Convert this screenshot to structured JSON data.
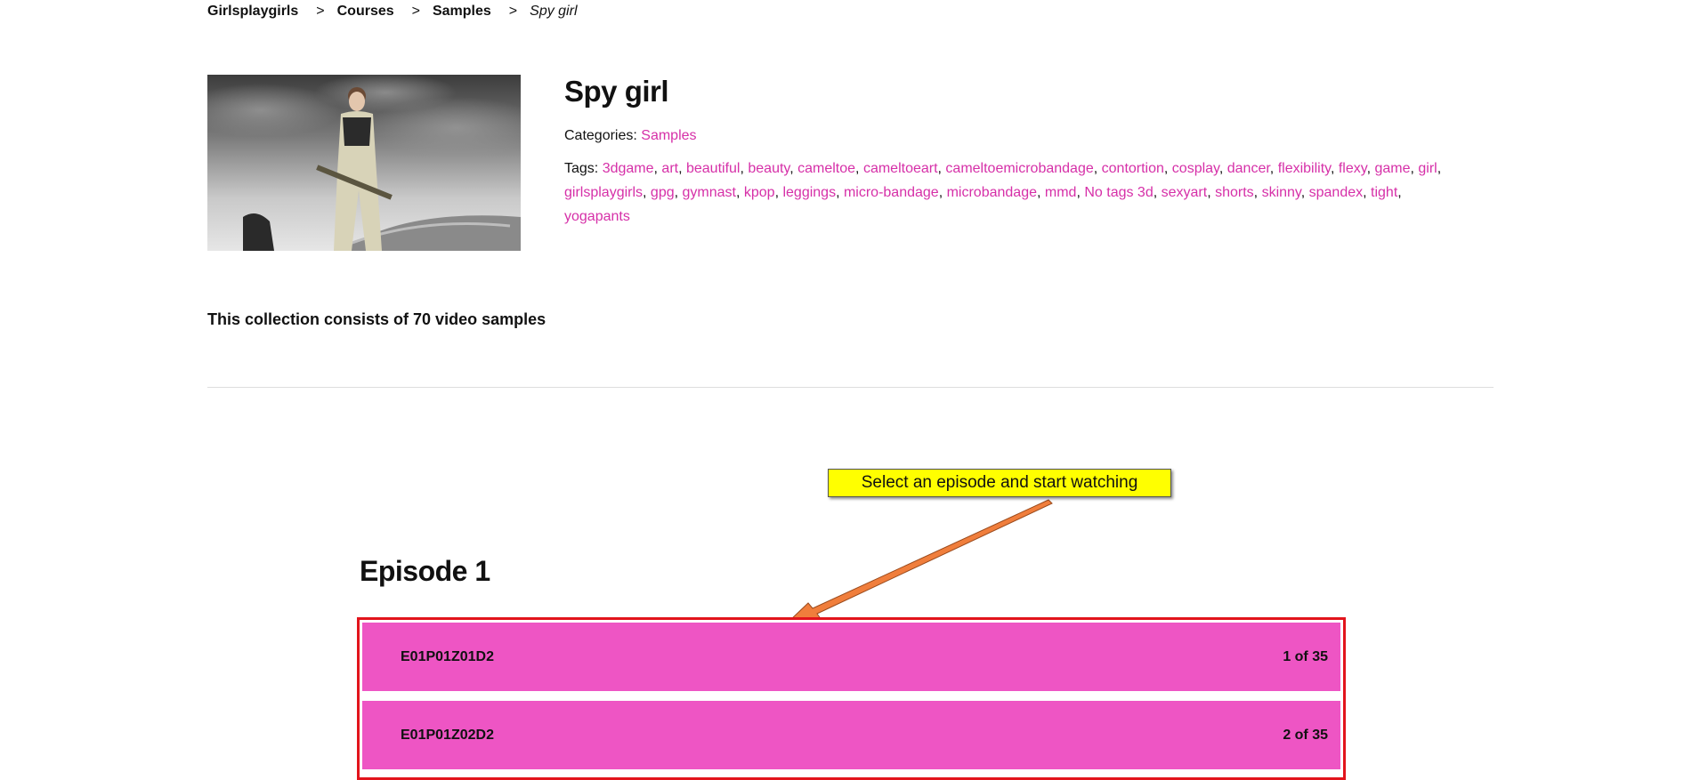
{
  "breadcrumb": {
    "items": [
      "Girlsplaygirls",
      "Courses",
      "Samples"
    ],
    "current": "Spy girl",
    "separator": ">"
  },
  "course": {
    "title": "Spy girl",
    "categories_label": "Categories:",
    "category": "Samples",
    "tags_label": "Tags:",
    "tags": [
      "3dgame",
      "art",
      "beautiful",
      "beauty",
      "cameltoe",
      "cameltoeart",
      "cameltoemicrobandage",
      "contortion",
      "cosplay",
      "dancer",
      "flexibility",
      "flexy",
      "game",
      "girl",
      "girlsplaygirls",
      "gpg",
      "gymnast",
      "kpop",
      "leggings",
      "micro-bandage",
      "microbandage",
      "mmd",
      "No tags 3d",
      "sexyart",
      "shorts",
      "skinny",
      "spandex",
      "tight",
      "yogapants"
    ],
    "collection_text": "This collection consists of 70 video samples"
  },
  "callout": {
    "text": "Select an episode and start watching"
  },
  "episode": {
    "title": "Episode 1",
    "items": [
      {
        "name": "E01P01Z01D2",
        "count": "1 of 35"
      },
      {
        "name": "E01P01Z02D2",
        "count": "2 of 35"
      }
    ]
  },
  "colors": {
    "accent": "#d630a8",
    "row_bg": "#ee55c4",
    "highlight_border": "#e2141c",
    "callout_bg": "#ffff00",
    "arrow": "#f07e3c"
  }
}
